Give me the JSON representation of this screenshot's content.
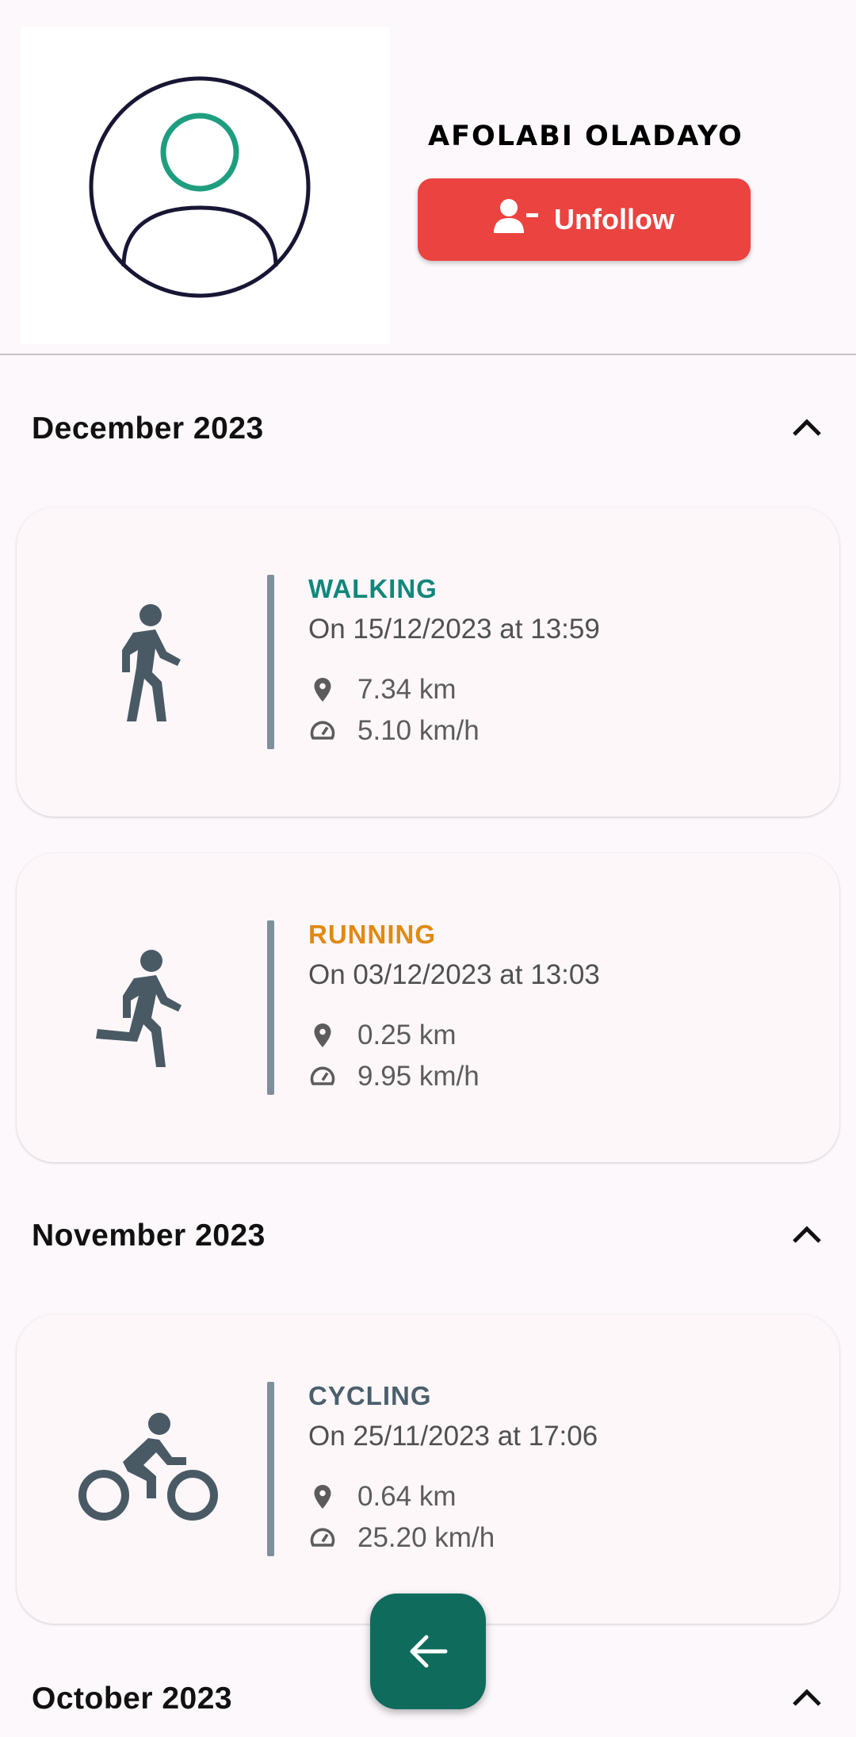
{
  "profile": {
    "name": "AFOLABI OLADAYO",
    "unfollow_label": "Unfollow"
  },
  "months": [
    {
      "title": "December 2023",
      "activities": [
        {
          "type": "WALKING",
          "color": "#11877a",
          "icon": "walking-icon",
          "date": "On 15/12/2023 at 13:59",
          "distance": "7.34 km",
          "speed": "5.10 km/h"
        },
        {
          "type": "RUNNING",
          "color": "#e08a12",
          "icon": "running-icon",
          "date": "On 03/12/2023 at 13:03",
          "distance": "0.25 km",
          "speed": "9.95 km/h"
        }
      ]
    },
    {
      "title": "November 2023",
      "activities": [
        {
          "type": "CYCLING",
          "color": "#4b5f6c",
          "icon": "cycling-icon",
          "date": "On 25/11/2023 at 17:06",
          "distance": "0.64 km",
          "speed": "25.20 km/h"
        }
      ]
    },
    {
      "title": "October 2023",
      "activities": []
    }
  ],
  "colors": {
    "accent": "#0f6b5c",
    "unfollow": "#ea4340",
    "icon": "#4a5a65"
  }
}
